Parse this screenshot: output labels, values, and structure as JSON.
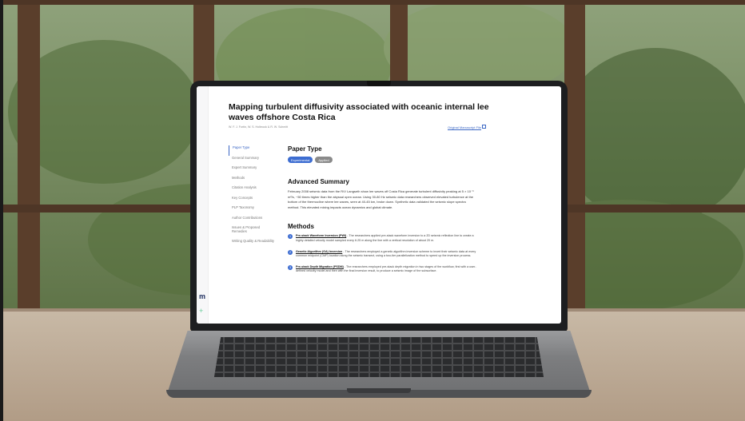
{
  "paper": {
    "title": "Mapping turbulent diffusivity associated with oceanic internal lee waves offshore Costa Rica",
    "authors": "W. F. J. Fortin, W. S. Holbrook & R. W. Schmitt",
    "manuscript_link": "Original Manuscript File"
  },
  "nav": {
    "items": [
      {
        "label": "Paper Type",
        "active": true
      },
      {
        "label": "General Summary"
      },
      {
        "label": "Expert Summary"
      },
      {
        "label": "Methods"
      },
      {
        "label": "Citation Analysis"
      },
      {
        "label": "Key Concepts"
      },
      {
        "label": "PLP Taxonomy"
      },
      {
        "label": "Author Contributions"
      },
      {
        "label": "Issues & Proposed Remedies"
      },
      {
        "label": "Writing Quality & Readability"
      }
    ]
  },
  "sections": {
    "paper_type": {
      "heading": "Paper Type",
      "tags": [
        "Experimental",
        "Applied"
      ]
    },
    "advanced_summary": {
      "heading": "Advanced Summary",
      "text": "February 2008 seismic data from the R/V Langseth show lee waves off Costa Rica generate turbulent diffusivity peaking at 5 × 10⁻³ m²/s, ~50 times higher than the abyssal open ocean. Using 30-80 Hz seismic data researchers observed elevated turbulence at the bottom of the thermocline where lee waves, seen at 40-45 km, broke down. Synthetic data validated the seismic slope spectra method. This elevated mixing impacts ocean dynamics and global climate."
    },
    "methods": {
      "heading": "Methods",
      "items": [
        {
          "num": "1",
          "name": "Pre-stack Waveform Inversion (PWI)",
          "text": " - The researchers applied pre-stack waveform inversion to a 2D seismic reflection line to create a highly detailed velocity model sampled every 6.25 m along the line with a vertical resolution of about 20 m."
        },
        {
          "num": "2",
          "name": "Genetic Algorithm (GA) Inversion",
          "text": " - The researchers employed a genetic algorithm inversion scheme to invert their seismic data at every common midpoint (CMP) location along the seismic transect, using a two-tier parallelization method to speed up the inversion process."
        },
        {
          "num": "3",
          "name": "Pre-stack Depth Migration (PSDM)",
          "text": " - The researchers employed pre-stack depth migration in two stages of the workflow, first with a user-defined velocity model and then with the final inversion result, to produce a seismic image of the subsurface."
        }
      ]
    }
  },
  "rail": {
    "logo": "m",
    "plus": "+"
  },
  "colors": {
    "accent": "#3d6dd1",
    "tag_gray": "#8a8a8a",
    "link": "#3a66c4"
  }
}
